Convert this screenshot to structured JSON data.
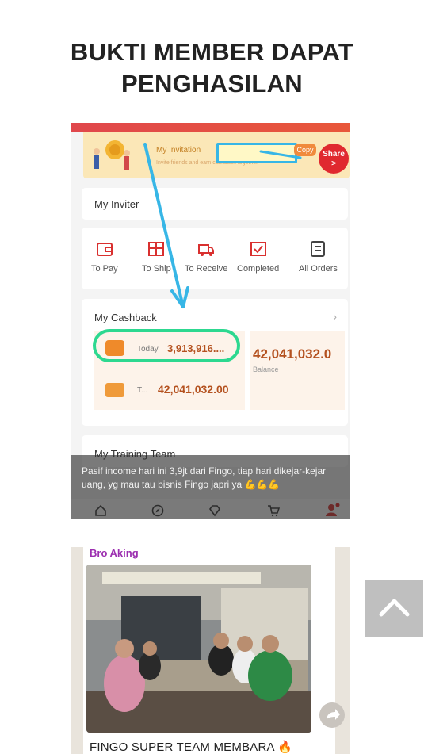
{
  "title": {
    "line1": "BUKTI MEMBER DAPAT",
    "line2": "PENGHASILAN"
  },
  "invitation": {
    "label": "My Invitation",
    "subtitle": "Invite friends and earn cashback together",
    "copy_label": "Copy",
    "share_label": "Share",
    "share_arrow": ">"
  },
  "inviter": {
    "label": "My Inviter"
  },
  "orders": {
    "items": [
      {
        "label": "To Pay",
        "icon": "wallet-icon"
      },
      {
        "label": "To Ship",
        "icon": "box-icon"
      },
      {
        "label": "To Receive",
        "icon": "truck-icon"
      },
      {
        "label": "Completed",
        "icon": "check-icon"
      },
      {
        "label": "All Orders",
        "icon": "list-icon"
      }
    ]
  },
  "cashback": {
    "title": "My Cashback",
    "today_label": "Today",
    "today_value": "3,913,916....",
    "total_label": "T...",
    "total_value": "42,041,032.00",
    "balance_value": "42,041,032.0",
    "balance_label": "Balance"
  },
  "training": {
    "label": "My Training Team"
  },
  "caption": {
    "text": "Pasif income hari ini 3,9jt dari Fingo, tiap hari dikejar-kejar uang, yg mau tau bisnis Fingo japri ya 💪💪💪"
  },
  "chat": {
    "sender": "Bro Aking",
    "message": "FINGO SUPER TEAM MEMBARA 🔥"
  },
  "colors": {
    "accent_orange": "#b4511f",
    "highlight_green": "#2dd890",
    "arrow_blue": "#37b6e6",
    "share_red": "#e0292f",
    "sender_purple": "#9c2fb0"
  }
}
